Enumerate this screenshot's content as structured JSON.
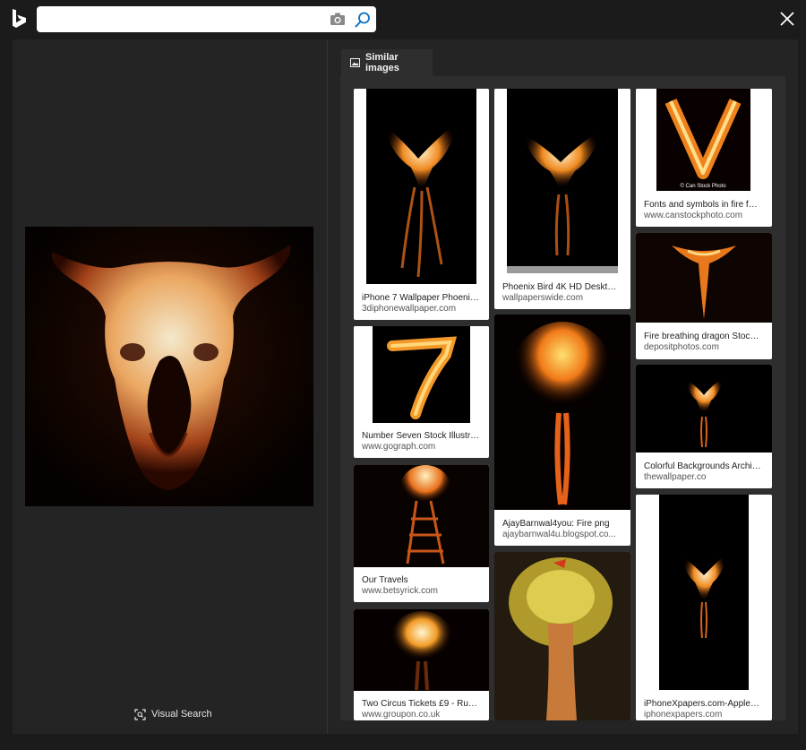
{
  "search": {
    "value": "",
    "placeholder": ""
  },
  "icons": {
    "logo": "bing-logo-icon",
    "camera": "camera-icon",
    "search": "search-icon",
    "close": "close-icon",
    "visual_search": "visual-search-icon",
    "tab": "image-icon"
  },
  "left": {
    "visual_search_label": "Visual Search"
  },
  "tabs": [
    {
      "label": "Similar images"
    }
  ],
  "results": [
    {
      "title": "iPhone 7 Wallpaper Phoenix | ...",
      "domain": "3diphonewallpaper.com"
    },
    {
      "title": "Number Seven Stock Illustrati...",
      "domain": "www.gograph.com"
    },
    {
      "title": "Our Travels",
      "domain": "www.betsyrick.com"
    },
    {
      "title": "Two Circus Tickets £9 - Russel...",
      "domain": "www.groupon.co.uk"
    },
    {
      "title": "Phoenix Bird 4K HD Desktop ...",
      "domain": "wallpaperswide.com"
    },
    {
      "title": "AjayBarnwal4you: Fire png",
      "domain": "ajaybarnwal4u.blogspot.co..."
    },
    {
      "title": "Fonts and symbols in fire for d...",
      "domain": "www.canstockphoto.com",
      "watermark": "© Can Stock Photo"
    },
    {
      "title": "Fire breathing dragon Stock P...",
      "domain": "depositphotos.com"
    },
    {
      "title": "Colorful Backgrounds Archive...",
      "domain": "thewallpaper.co"
    },
    {
      "title": "iPhoneXpapers.com-Apple-iPh...",
      "domain": "iphonexpapers.com"
    }
  ],
  "colors": {
    "background": "#1b1b1b",
    "panel": "#242424",
    "results_bg": "#2e2e2e",
    "accent": "#0a6fc2"
  }
}
